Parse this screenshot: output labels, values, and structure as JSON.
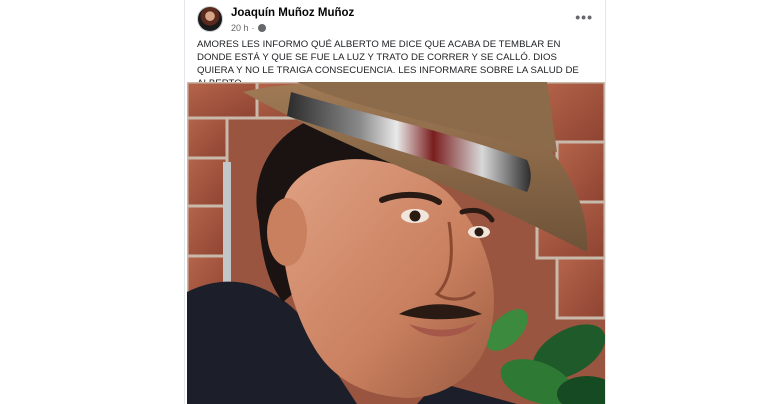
{
  "post": {
    "author": "Joaquín Muñoz Muñoz",
    "time": "20 h",
    "meta_separator": "·",
    "text": "AMORES LES INFORMO QUÉ ALBERTO ME DICE  QUE ACABA DE TEMBLAR EN DONDE ESTÁ Y QUE SE FUE LA LUZ Y TRATO DE CORRER Y SE CALLÓ. DIOS QUIERA Y NO LE TRAIGA CONSECUENCIA. LES INFORMARE SOBRE LA SALUD DE ALBERTO.",
    "more_options_label": "•••"
  },
  "icons": {
    "avatar": "avatar-photo",
    "audience": "globe-icon",
    "menu": "more-options-icon"
  },
  "colors": {
    "author_text": "#050505",
    "meta_text": "#65676b",
    "body_text": "#1c1e21"
  }
}
